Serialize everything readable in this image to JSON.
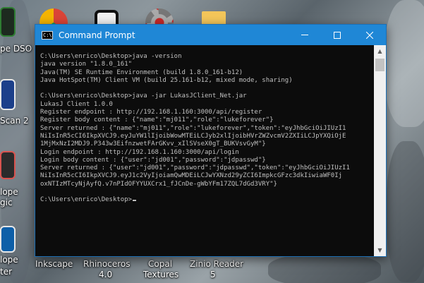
{
  "desktop": {
    "left_labels": [
      "pe DSO",
      "Scan 2",
      "lope",
      "gic",
      "lope",
      "ter"
    ],
    "bottom_icons": [
      {
        "label1": "Inkscape",
        "label2": ""
      },
      {
        "label1": "Rhinoceros",
        "label2": "4.0"
      },
      {
        "label1": "Copal",
        "label2": "Textures"
      },
      {
        "label1": "Zinio Reader",
        "label2": "5"
      }
    ],
    "top_icons": [
      "chrome-icon",
      "tablet-icon",
      "settings-gear-icon",
      "folder-icon"
    ]
  },
  "window": {
    "title": "Command Prompt",
    "icon_text": "C:\\",
    "accent": "#1f87d6",
    "buttons": {
      "minimize": "—",
      "maximize": "☐",
      "close": "✕"
    }
  },
  "console": {
    "lines": [
      "C:\\Users\\enrico\\Desktop>java -version",
      "java version \"1.8.0_161\"",
      "Java(TM) SE Runtime Environment (build 1.8.0_161-b12)",
      "Java HotSpot(TM) Client VM (build 25.161-b12, mixed mode, sharing)",
      "",
      "C:\\Users\\enrico\\Desktop>java -jar LukasJClient_Net.jar",
      "LukasJ Client 1.0.0",
      "Register endpoint : http://192.168.1.160:3000/api/register",
      "Register body content : {\"name\":\"mj011\",\"role\":\"lukeforever\"}",
      "Server returned : {\"name\":\"mj011\",\"role\":\"lukeforever\",\"token\":\"eyJhbGciOiJIUzI1",
      "NiIsInR5cCI6IkpXVCJ9.eyJuYW1lIjoibWowMTEiLCJyb2xlIjoibHVrZWZvcmV2ZXIiLCJpYXQiOjE",
      "1MjMxNzI2MDJ9.P343w3EifnzwetFArGKvv_xIlSVseX0gT_BUKVsvGyM\"}",
      "Login endpoint : http://192.168.1.160:3000/api/login",
      "Login body content : {\"user\":\"jd001\",\"password\":\"jdpasswd\"}",
      "Server returned : {\"user\":\"jd001\",\"password\":\"jdpasswd\",\"token\":\"eyJhbGciOiJIUzI1",
      "NiIsInR5cCI6IkpXVCJ9.eyJ1c2VyIjoiamQwMDEiLCJwYXNzd29yZCI6ImpkcGFzc3dkIiwiaWF0Ij",
      "oxNTIzMTcyNjAyfQ.v7nPIdOFYYUXCrx1_fJCnDe-gWbYFm17ZQL7dGd3VRY\"}",
      "",
      "C:\\Users\\enrico\\Desktop>"
    ]
  }
}
